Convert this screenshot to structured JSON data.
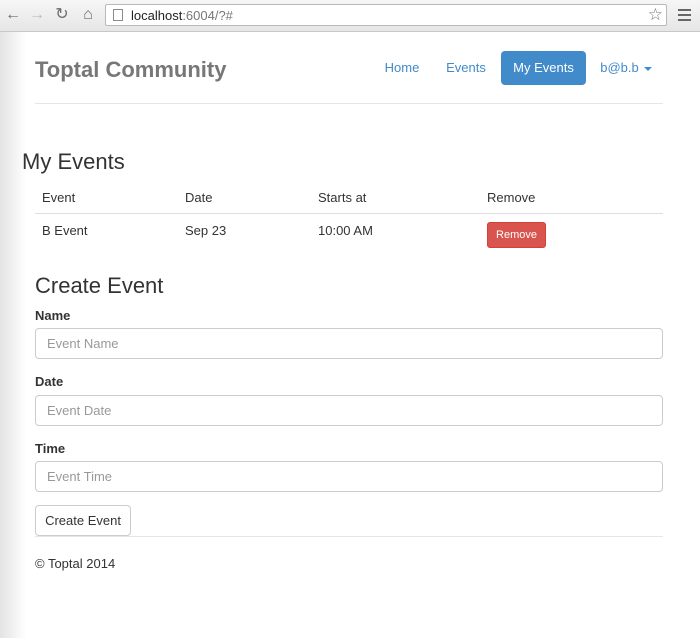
{
  "browser": {
    "url_host": "localhost",
    "url_rest": ":6004/?#"
  },
  "navbar": {
    "brand": "Toptal Community",
    "links": [
      {
        "label": "Home"
      },
      {
        "label": "Events"
      },
      {
        "label": "My Events",
        "active": true
      },
      {
        "label": "b@b.b"
      }
    ]
  },
  "my_events": {
    "title": "My Events",
    "columns": [
      "Event",
      "Date",
      "Starts at",
      "Remove"
    ],
    "rows": [
      {
        "event": "B Event",
        "date": "Sep 23",
        "starts_at": "10:00 AM",
        "action": "Remove"
      }
    ]
  },
  "create_event": {
    "title": "Create Event",
    "fields": [
      {
        "label": "Name",
        "placeholder": "Event Name"
      },
      {
        "label": "Date",
        "placeholder": "Event Date"
      },
      {
        "label": "Time",
        "placeholder": "Event Time"
      }
    ],
    "submit_label": "Create Event"
  },
  "footer": {
    "text": "© Toptal 2014"
  },
  "colors": {
    "primary": "#428bca",
    "danger": "#d9534f",
    "brand_text": "#777777"
  }
}
